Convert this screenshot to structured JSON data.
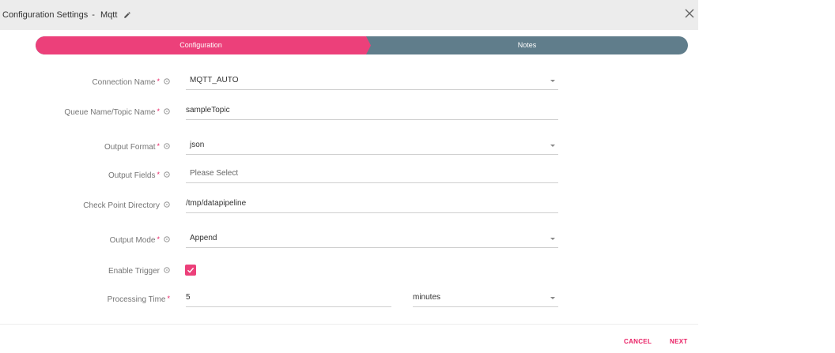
{
  "header": {
    "title": "Configuration Settings",
    "separator": "-",
    "connector": "Mqtt"
  },
  "stepper": {
    "steps": [
      {
        "label": "Configuration"
      },
      {
        "label": "Notes"
      }
    ]
  },
  "form": {
    "connection_name": {
      "label": "Connection Name",
      "value": "MQTT_AUTO"
    },
    "queue_name": {
      "label": "Queue Name/Topic Name",
      "value": "sampleTopic"
    },
    "output_format": {
      "label": "Output Format",
      "value": "json"
    },
    "output_fields": {
      "label": "Output Fields",
      "placeholder": "Please Select"
    },
    "checkpoint_dir": {
      "label": "Check Point Directory",
      "value": "/tmp/datapipeline"
    },
    "output_mode": {
      "label": "Output Mode",
      "value": "Append"
    },
    "enable_trigger": {
      "label": "Enable Trigger",
      "checked": true
    },
    "processing_time": {
      "label": "Processing Time",
      "value": "5",
      "unit": "minutes"
    }
  },
  "required_marker": "*",
  "footer": {
    "cancel_label": "CANCEL",
    "next_label": "NEXT"
  },
  "colors": {
    "accent": "#ec407a",
    "step_inactive": "#607d8b",
    "header_bg": "#ececec"
  }
}
